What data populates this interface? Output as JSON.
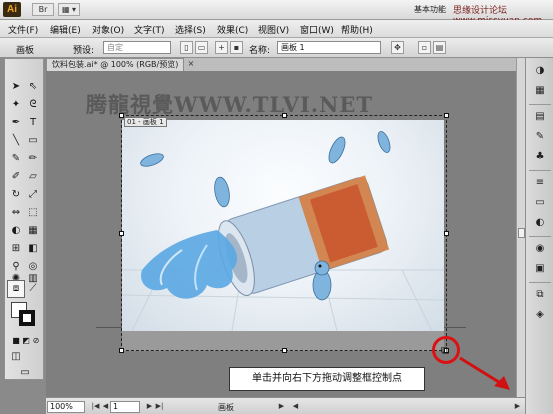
{
  "app": {
    "logo": "Ai",
    "workspace": "基本功能",
    "watermark_top": "思缘设计论坛 www.missyuan.com"
  },
  "menu": {
    "items": [
      "文件(F)",
      "编辑(E)",
      "对象(O)",
      "文字(T)",
      "选择(S)",
      "效果(C)",
      "视图(V)",
      "窗口(W)",
      "帮助(H)"
    ]
  },
  "control_bar": {
    "panel_label": "画板",
    "preset_label": "预设:",
    "preset_value": "自定",
    "name_label": "名称:",
    "name_value": "画板 1"
  },
  "document": {
    "tab_title": "饮料包装.ai* @ 100% (RGB/预览)",
    "close_glyph": "×",
    "artboard_label": "01 - 画板 1",
    "canvas_watermark": "腾龍視覺WWW.TLVI.NET"
  },
  "callout": {
    "text": "单击并向右下方拖动调整框控制点"
  },
  "status_bar": {
    "zoom": "100%",
    "page": "1",
    "mode": "画板"
  },
  "icons": {
    "accent_red": "#d11111"
  }
}
